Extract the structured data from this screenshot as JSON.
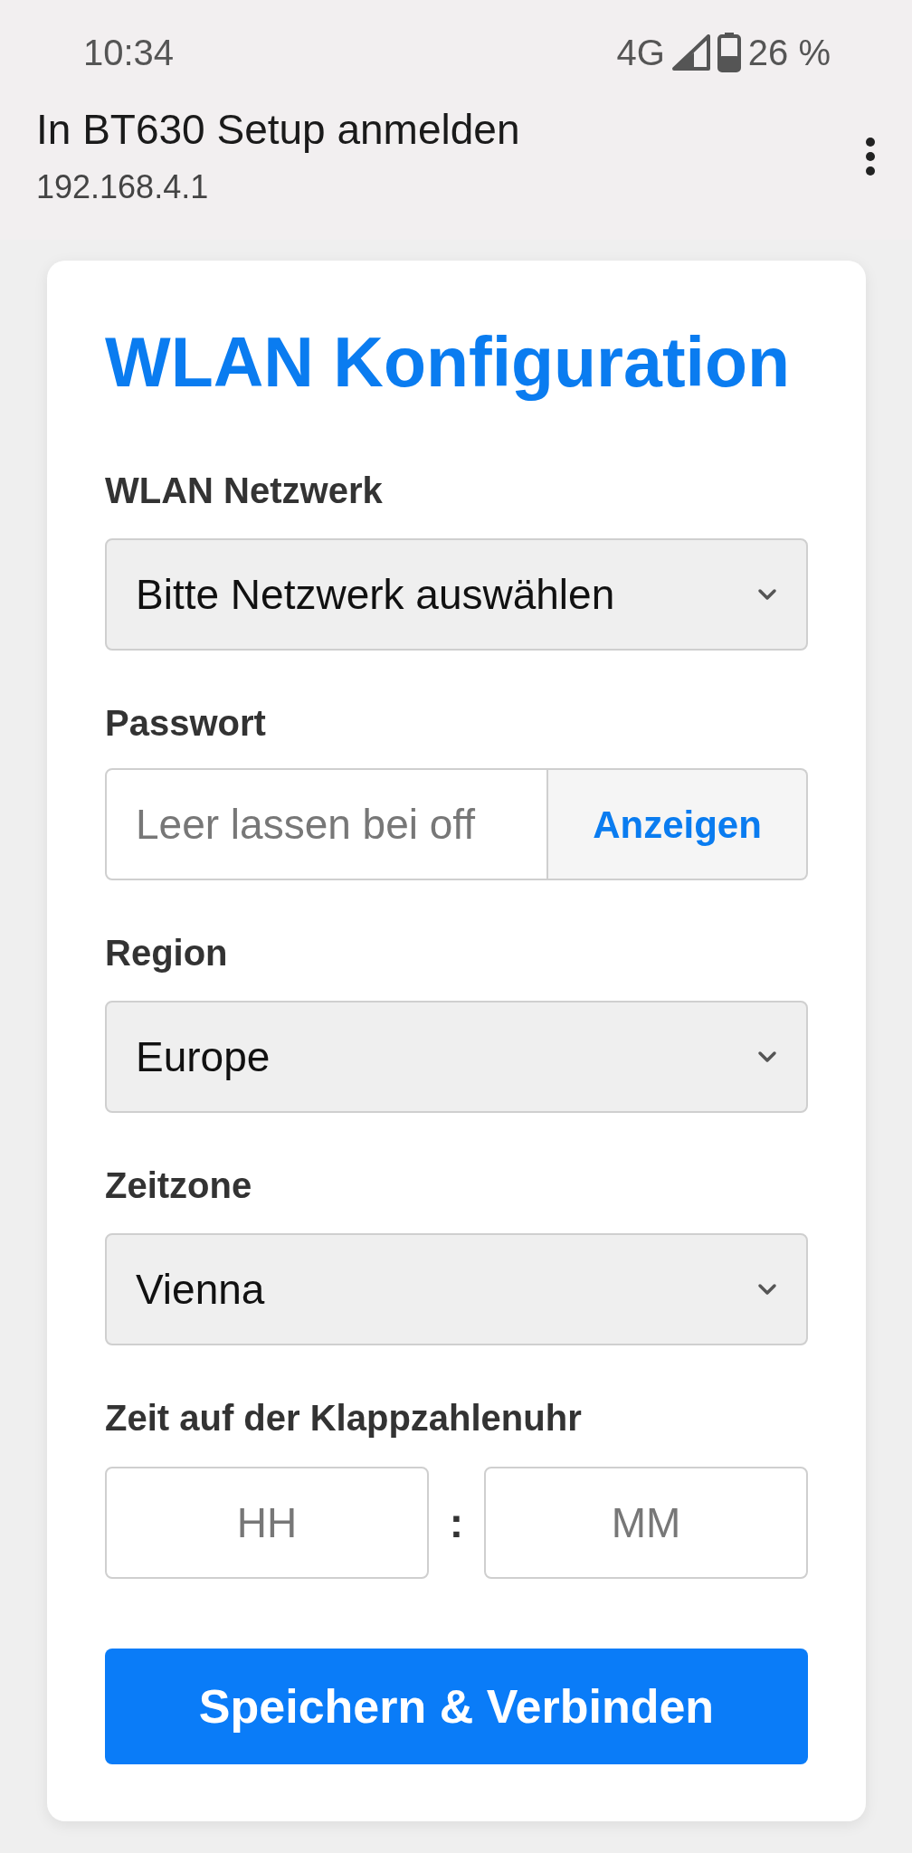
{
  "status_bar": {
    "time": "10:34",
    "network": "4G",
    "battery": "26 %"
  },
  "header": {
    "title": "In BT630 Setup anmelden",
    "url": "192.168.4.1"
  },
  "card": {
    "title": "WLAN Konfiguration",
    "fields": [
      {
        "kind": "select",
        "label": "WLAN Netzwerk",
        "value": "Bitte Netzwerk auswählen"
      },
      {
        "kind": "password",
        "label": "Passwort",
        "placeholder": "Leer lassen bei off",
        "button": "Anzeigen"
      },
      {
        "kind": "select",
        "label": "Region",
        "value": "Europe"
      },
      {
        "kind": "select",
        "label": "Zeitzone",
        "value": "Vienna"
      },
      {
        "kind": "time",
        "label": "Zeit auf der Klappzahlenuhr",
        "hours_placeholder": "HH",
        "separator": ":",
        "minutes_placeholder": "MM"
      }
    ],
    "submit": "Speichern & Verbinden"
  }
}
